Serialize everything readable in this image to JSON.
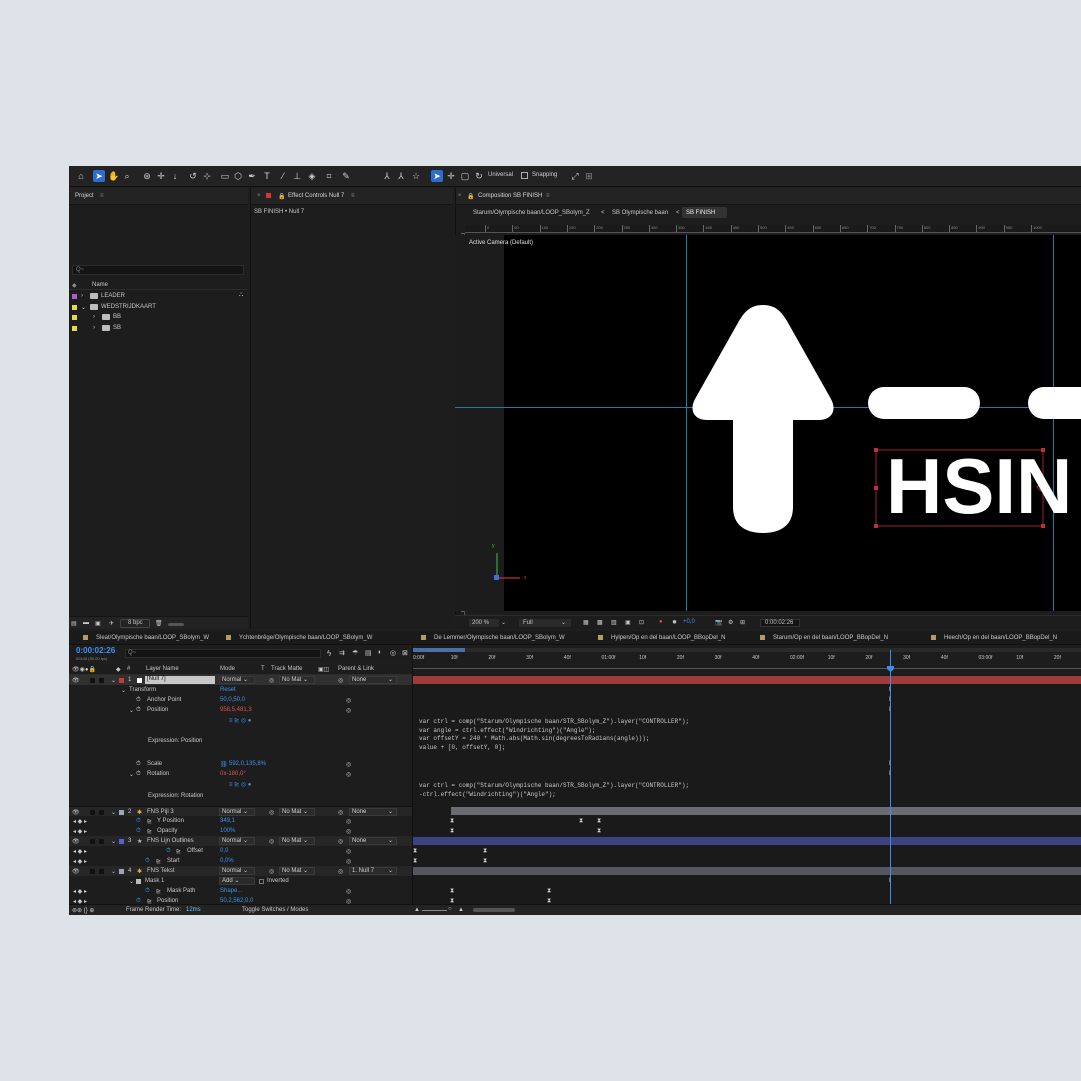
{
  "toolbar": {
    "universal_label": "Universal",
    "snapping_label": "Snapping"
  },
  "project": {
    "title": "Project",
    "search_placeholder": "Q~",
    "name_header": "Name",
    "items": [
      {
        "name": "LEADER",
        "color": "#b05ad0",
        "indent": 0
      },
      {
        "name": "WEDSTRIJDKAART",
        "color": "#e6d84a",
        "indent": 0
      },
      {
        "name": "BB",
        "color": "#e6d84a",
        "indent": 1
      },
      {
        "name": "SB",
        "color": "#e6d84a",
        "indent": 1
      }
    ],
    "bpc": "8 bpc"
  },
  "effect_controls": {
    "title": "Effect Controls Null 7",
    "subtitle": "SB FINISH • Null 7"
  },
  "composition": {
    "title": "Composition SB FINISH",
    "breadcrumbs": [
      "Starum/Olympische baan/LOOP_SBolym_Z",
      "SB Olympische baan",
      "SB FINISH"
    ],
    "camera_label": "Active Camera (Default)",
    "ruler_ticks": [
      "0",
      "50",
      "100",
      "150",
      "200",
      "250",
      "300",
      "350",
      "400",
      "450",
      "500",
      "550",
      "600",
      "650",
      "700",
      "750",
      "800",
      "850",
      "900",
      "950",
      "1000"
    ],
    "text_content": "HSIN",
    "zoom": "200 %",
    "resolution": "Full",
    "exposure": "+0,0",
    "timecode": "0:00:02:26"
  },
  "tabs": [
    "Sleat/Olympische baan/LOOP_SBolym_W",
    "Ychtenbrêge/Olympische baan/LOOP_SBolym_W",
    "De Lemmer/Olympische baan/LOOP_SBolym_W",
    "Hylpen/Op en del baan/LOOP_BBopDel_N",
    "Starum/Op en del baan/LOOP_BBopDel_N",
    "Heech/Op en del baan/LOOP_BBopDel_N"
  ],
  "timeline": {
    "timecode": "0:00:02:26",
    "fps_label": "00146 (50.00 fps)",
    "search_placeholder": "Q~",
    "col_num": "#",
    "col_layer_name": "Layer Name",
    "col_mode": "Mode",
    "col_t": "T",
    "col_track_matte": "Track Matte",
    "col_parent": "Parent & Link",
    "ruler": [
      "0:00f",
      "10f",
      "20f",
      "30f",
      "40f",
      "01:00f",
      "10f",
      "20f",
      "30f",
      "40f",
      "02:00f",
      "10f",
      "20f",
      "30f",
      "40f",
      "03:00f",
      "10f",
      "20f"
    ],
    "layers": {
      "l1_num": "1",
      "l1_name": "[Null 7]",
      "l1_mode": "Normal",
      "l1_matte": "No Mat",
      "l1_parent": "None",
      "transform": "Transform",
      "reset": "Reset",
      "anchor_label": "Anchor Point",
      "anchor_val": "50,0,50,0",
      "position_label": "Position",
      "position_val": "958,5,481,3",
      "expr_position_label": "Expression: Position",
      "scale_label": "Scale",
      "scale_val": "592,0,135,8%",
      "rotation_label": "Rotation",
      "rotation_val": "0x-180,0°",
      "expr_rotation_label": "Expression: Rotation",
      "l2_num": "2",
      "l2_name": "FNS Pijl 3",
      "l2_mode": "Normal",
      "l2_matte": "No Mat",
      "l2_parent": "None",
      "ypos_label": "Y Position",
      "ypos_val": "349,1",
      "opacity_label": "Opacity",
      "opacity_val": "100%",
      "l3_num": "3",
      "l3_name": "FNS Lijn Outlines",
      "l3_mode": "Normal",
      "l3_matte": "No Mat",
      "l3_parent": "None",
      "offset_label": "Offset",
      "offset_val": "0,0",
      "start_label": "Start",
      "start_val": "0,0%",
      "l4_num": "4",
      "l4_name": "FNS Tekst",
      "l4_mode": "Normal",
      "l4_matte": "No Mat",
      "l4_parent": "1. Null 7",
      "mask_label": "Mask 1",
      "mask_mode": "Add",
      "inverted": "Inverted",
      "maskpath_label": "Mask Path",
      "maskpath_val": "Shape...",
      "pos2_label": "Position",
      "pos2_val": "50,2,562,0,0"
    },
    "expr_position": [
      "var ctrl = comp(\"Starum/Olympische baan/STR_SBolym_Z\").layer(\"CONTROLLER\");",
      "var angle = ctrl.effect(\"Windrichting\")(\"Angle\");",
      "var offsetY = 240 * Math.abs(Math.sin(degreesToRadians(angle)));",
      "value + [0, offsetY, 0];"
    ],
    "expr_rotation": [
      "var ctrl = comp(\"Starum/Olympische baan/STR_SBolym_Z\").layer(\"CONTROLLER\");",
      "-ctrl.effect(\"Windrichting\")(\"Angle\");"
    ],
    "frame_render_label": "Frame Render Time:",
    "frame_render_value": "12ms",
    "toggle_label": "Toggle Switches / Modes"
  }
}
